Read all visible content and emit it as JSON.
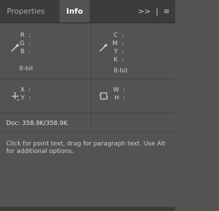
{
  "tabs": [
    "Properties",
    "Info"
  ],
  "tab_menu": {
    "overflow_label": ">>",
    "separator": "|",
    "menu_label": "≡"
  },
  "rgb": {
    "labels": [
      "R",
      "G",
      "B"
    ],
    "values": [
      "",
      "",
      ""
    ],
    "bit_depth": "8-bit"
  },
  "cmyk": {
    "labels": [
      "C",
      "M",
      "Y",
      "K"
    ],
    "values": [
      "",
      "",
      "",
      ""
    ],
    "bit_depth": "8-bit"
  },
  "position": {
    "labels": [
      "X",
      "Y"
    ],
    "values": [
      "",
      ""
    ]
  },
  "size": {
    "labels": [
      "W",
      "H"
    ],
    "values": [
      "",
      ""
    ]
  },
  "doc": "Doc: 358.9K/358.9K",
  "hint": "Click for point text, drag for paragraph text. Use Alt for additional options."
}
